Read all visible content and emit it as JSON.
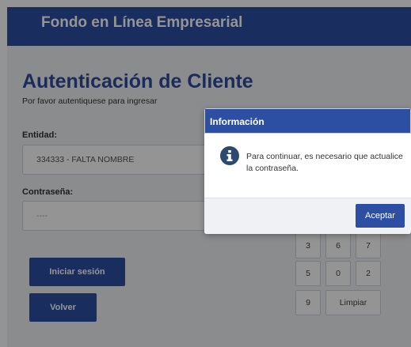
{
  "header": {
    "title": "Fondo en Línea Empresarial"
  },
  "main": {
    "heading": "Autenticación de Cliente",
    "subheading": "Por favor autentiquese para ingresar"
  },
  "form": {
    "entity_label": "Entidad:",
    "entity_value": "334333 - FALTA NOMBRE",
    "password_label": "Contraseña:",
    "password_value": "----"
  },
  "buttons": {
    "login": "Iniciar sesión",
    "back": "Volver"
  },
  "keypad": {
    "keys": [
      "3",
      "6",
      "7",
      "5",
      "0",
      "2",
      "9"
    ],
    "clear": "Limpiar"
  },
  "dialog": {
    "title": "Información",
    "message": "Para continuar, es necesario que actualice la contraseña.",
    "accept": "Aceptar"
  },
  "colors": {
    "primary": "#2c4fa3",
    "heading": "#2f4a9c",
    "info_icon": "#2c4a6e"
  }
}
